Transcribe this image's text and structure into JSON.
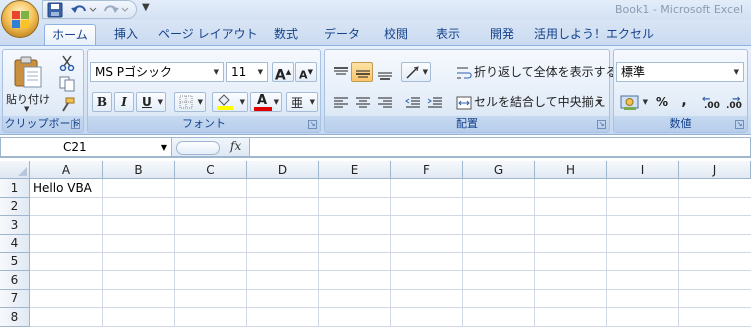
{
  "window": {
    "title": "Book1 - Microsoft Excel"
  },
  "quick_access": {
    "customize_glyph": "▼"
  },
  "tabs": [
    {
      "label": "ホーム",
      "active": true
    },
    {
      "label": "挿入"
    },
    {
      "label": "ページ レイアウト"
    },
    {
      "label": "数式"
    },
    {
      "label": "データ"
    },
    {
      "label": "校閲"
    },
    {
      "label": "表示"
    },
    {
      "label": "開発"
    },
    {
      "label": "活用しよう！エクセル"
    }
  ],
  "ribbon": {
    "clipboard": {
      "label": "クリップボード",
      "paste_label": "貼り付け"
    },
    "font": {
      "label": "フォント",
      "font_name": "MS Pゴシック",
      "font_size": "11",
      "bold": "B",
      "italic": "I",
      "underline": "U",
      "grow": "A",
      "shrink": "A",
      "font_color_glyph": "A",
      "phonetic_glyph": "亜"
    },
    "alignment": {
      "label": "配置",
      "wrap_text": "折り返して全体を表示する",
      "merge_center": "セルを結合して中央揃え"
    },
    "number": {
      "label": "数値",
      "format": "標準",
      "percent": "%",
      "comma": ",",
      "inc_decimal": ".00",
      "dec_decimal": ".00"
    }
  },
  "formula_bar": {
    "name_box": "C21",
    "fx": "fx",
    "content": ""
  },
  "sheet": {
    "columns": [
      "A",
      "B",
      "C",
      "D",
      "E",
      "F",
      "G",
      "H",
      "I",
      "J"
    ],
    "rows": [
      "1",
      "2",
      "3",
      "4",
      "5",
      "6",
      "7",
      "8"
    ],
    "cells": {
      "A1": "Hello VBA"
    }
  },
  "colors": {
    "ribbon_text": "#15428b",
    "header_border": "#9eb6ce",
    "gridline": "#d0d7e5",
    "accent_pressed": "#fbc46a"
  }
}
